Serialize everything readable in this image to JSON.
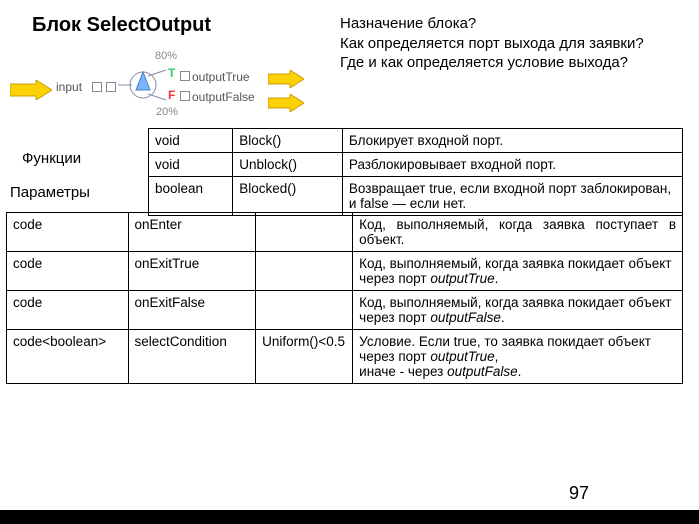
{
  "title": "Блок SelectOutput",
  "questions": "Назначение блока?\nКак определяется порт выхода для заявки?\nГде и как определяется условие выхода?",
  "diagram": {
    "input": "input",
    "pct80": "80%",
    "pct20": "20%",
    "T": "T",
    "F": "F",
    "outTrue": "outputTrue",
    "outFalse": "outputFalse"
  },
  "labels": {
    "functions": "Функции",
    "parameters": "Параметры"
  },
  "funcTable": [
    {
      "ret": "void",
      "name": "Block()",
      "desc": "Блокирует входной порт."
    },
    {
      "ret": "void",
      "name": "Unblock()",
      "desc": "Разблокировывает входной порт."
    },
    {
      "ret": "boolean",
      "name": "Blocked()",
      "desc": "Возвращает true, если входной порт заблокирован, и false — если нет."
    }
  ],
  "paramTable": [
    {
      "type": "code",
      "name": "onEnter",
      "def": "",
      "desc": "Код, выполняемый, когда заявка поступает в объект."
    },
    {
      "type": "code",
      "name": "onExitTrue",
      "def": "",
      "desc": "Код, выполняемый, когда заявка покидает объект через порт outputTrue."
    },
    {
      "type": "code",
      "name": "onExitFalse",
      "def": "",
      "desc": "Код, выполняемый, когда заявка покидает объект через порт outputFalse."
    },
    {
      "type": "code<boolean>",
      "name": "selectCondition",
      "def": "Uniform()<0.5",
      "desc": "Условие. Если true, то заявка покидает объект через порт outputTrue,\nиначе - через outputFalse."
    }
  ],
  "page": "97"
}
